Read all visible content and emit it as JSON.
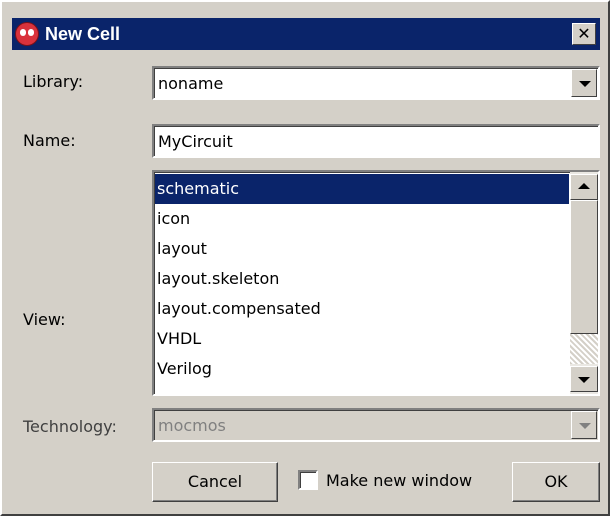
{
  "window": {
    "title": "New Cell",
    "close_symbol": "✕"
  },
  "library": {
    "label": "Library:",
    "value": "noname"
  },
  "name": {
    "label": "Name:",
    "value": "MyCircuit"
  },
  "view": {
    "label": "View:",
    "items": [
      "schematic",
      "icon",
      "layout",
      "layout.skeleton",
      "layout.compensated",
      "VHDL",
      "Verilog"
    ],
    "selected": "schematic"
  },
  "technology": {
    "label": "Technology:",
    "value": "mocmos",
    "enabled": false
  },
  "buttons": {
    "cancel": "Cancel",
    "ok": "OK"
  },
  "make_new_window": {
    "label": "Make new window",
    "checked": false
  },
  "icons": {
    "app": "electric-app-icon",
    "close": "close-icon",
    "dropdown": "chevron-down-icon",
    "scroll_up": "scroll-up-icon",
    "scroll_down": "scroll-down-icon"
  },
  "colors": {
    "titlebar": "#0a246a",
    "selection": "#0a246a",
    "face": "#d4d0c8"
  }
}
